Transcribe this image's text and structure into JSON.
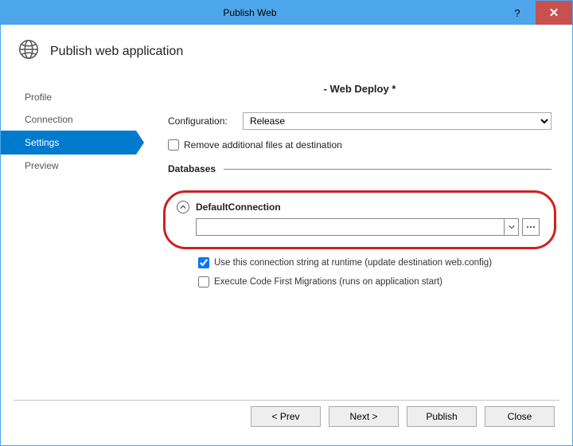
{
  "title": "Publish Web",
  "header": "Publish web application",
  "sidebar": {
    "items": [
      {
        "label": "Profile"
      },
      {
        "label": "Connection"
      },
      {
        "label": "Settings"
      },
      {
        "label": "Preview"
      }
    ],
    "activeIndex": 2
  },
  "main": {
    "deployTitle": "- Web Deploy *",
    "configLabel": "Configuration:",
    "configValue": "Release",
    "removeFiles": {
      "checked": false,
      "label": "Remove additional files at destination"
    },
    "databasesHeading": "Databases",
    "connection": {
      "name": "DefaultConnection",
      "value": "",
      "useAtRuntime": {
        "checked": true,
        "label": "Use this connection string at runtime (update destination web.config)"
      },
      "codeFirst": {
        "checked": false,
        "label": "Execute Code First Migrations (runs on application start)"
      }
    }
  },
  "footer": {
    "prev": "< Prev",
    "next": "Next >",
    "publish": "Publish",
    "close": "Close"
  },
  "titlebar": {
    "help": "?",
    "close": "✕"
  }
}
